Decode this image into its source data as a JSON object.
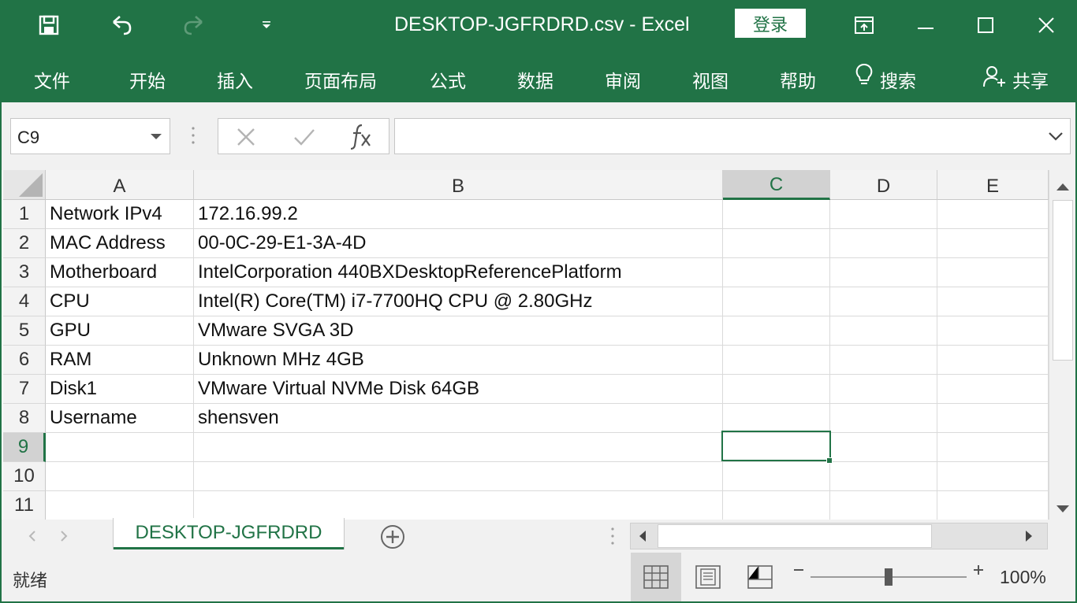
{
  "title_bar": {
    "window_title": "DESKTOP-JGFRDRD.csv  -  Excel",
    "login_label": "登录",
    "icons": [
      "save-icon",
      "undo-icon",
      "redo-icon",
      "customize-qat-icon",
      "ribbon-display-icon",
      "minimize-icon",
      "maximize-icon",
      "close-icon"
    ]
  },
  "ribbon": {
    "tabs": [
      "文件",
      "开始",
      "插入",
      "页面布局",
      "公式",
      "数据",
      "审阅",
      "视图",
      "帮助"
    ],
    "search_label": "搜索",
    "share_label": "共享"
  },
  "formula_bar": {
    "name_box": "C9",
    "formula_value": ""
  },
  "sheet": {
    "columns": [
      "A",
      "B",
      "C",
      "D",
      "E"
    ],
    "selected_column": "C",
    "selected_row": 9,
    "row_numbers": [
      "1",
      "2",
      "3",
      "4",
      "5",
      "6",
      "7",
      "8",
      "9",
      "10",
      "11"
    ],
    "rows": [
      [
        "Network IPv4",
        "172.16.99.2"
      ],
      [
        "MAC Address",
        "00-0C-29-E1-3A-4D"
      ],
      [
        "Motherboard",
        "IntelCorporation 440BXDesktopReferencePlatform"
      ],
      [
        "CPU",
        "Intel(R) Core(TM) i7-7700HQ CPU @ 2.80GHz"
      ],
      [
        "GPU",
        "VMware SVGA 3D"
      ],
      [
        "RAM",
        "Unknown MHz 4GB"
      ],
      [
        "Disk1",
        "VMware Virtual NVMe Disk 64GB"
      ],
      [
        "Username",
        "shensven"
      ],
      [
        "",
        ""
      ],
      [
        "",
        ""
      ],
      [
        "",
        ""
      ]
    ]
  },
  "sheet_tabs": {
    "active": "DESKTOP-JGFRDRD"
  },
  "status_bar": {
    "status": "就绪",
    "zoom": "100%"
  },
  "colors": {
    "accent": "#217346",
    "header_bg": "#f3f3f3",
    "selected_header_bg": "#d2d2d2"
  }
}
